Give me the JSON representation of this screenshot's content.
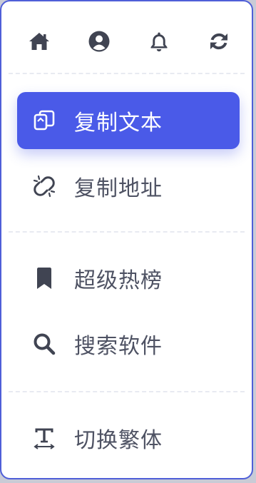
{
  "colors": {
    "accent": "#4a5ae8",
    "frame_border": "#4f5fd8",
    "icon": "#404452",
    "label": "#4e5263",
    "active_label": "#ffffff",
    "divider": "#e8eaf1"
  },
  "top_icons": [
    {
      "icon": "home-icon"
    },
    {
      "icon": "user-circle-icon"
    },
    {
      "icon": "bell-icon"
    },
    {
      "icon": "refresh-icon"
    }
  ],
  "menu": {
    "copy_text": {
      "label": "复制文本",
      "icon": "copy-icon",
      "active": true
    },
    "copy_url": {
      "label": "复制地址",
      "icon": "broken-link-icon",
      "active": false
    },
    "hot_list": {
      "label": "超级热榜",
      "icon": "bookmark-icon",
      "active": false
    },
    "search_software": {
      "label": "搜索软件",
      "icon": "search-icon",
      "active": false
    },
    "toggle_traditional": {
      "label": "切换繁体",
      "icon": "text-width-icon",
      "active": false
    }
  }
}
